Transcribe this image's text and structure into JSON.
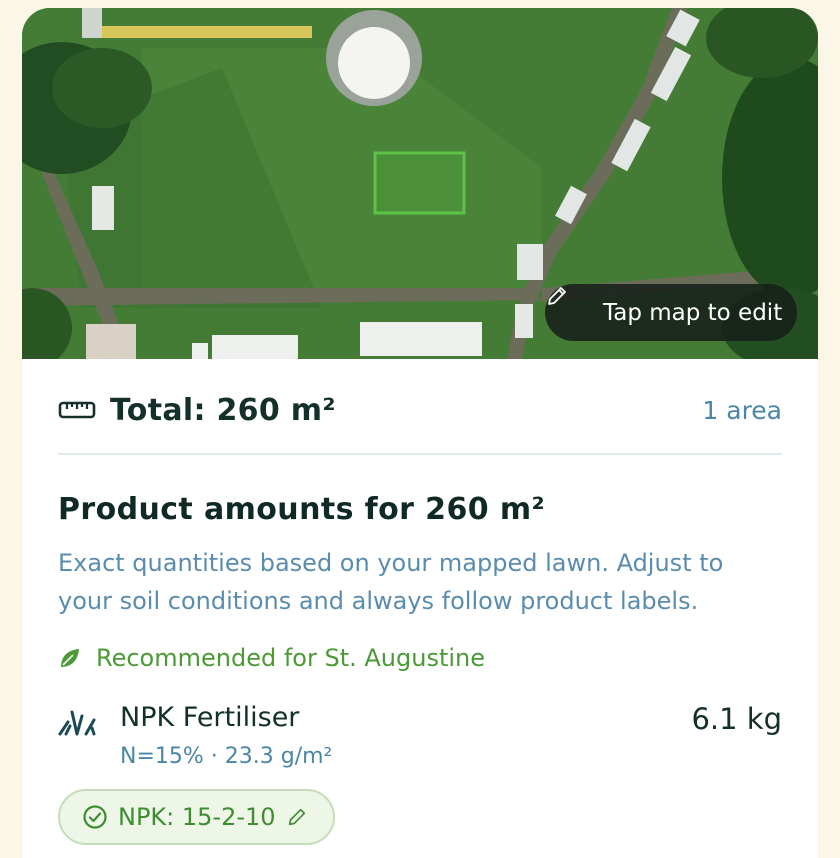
{
  "map": {
    "edit_button_label": "Tap map to edit",
    "pencil_icon": "pencil-icon"
  },
  "summary": {
    "ruler_icon": "ruler-icon",
    "total_label": "Total: 260 m²",
    "area_count": "1 area"
  },
  "products": {
    "title": "Product amounts for 260 m²",
    "description": "Exact quantities based on your mapped lawn. Adjust to your soil conditions and always follow product labels.",
    "recommendation": "Recommended for St. Augustine",
    "items": [
      {
        "name": "NPK Fertiliser",
        "detail": "N=15% · 23.3 g/m²",
        "amount": "6.1 kg",
        "icon": "grass-icon",
        "ratio_chip": "NPK: 15-2-10"
      }
    ]
  },
  "colors": {
    "page_bg": "#fbf6e6",
    "accent_green": "#4c9a36",
    "accent_blue": "#4a86a6",
    "text_dark": "#14302a"
  }
}
